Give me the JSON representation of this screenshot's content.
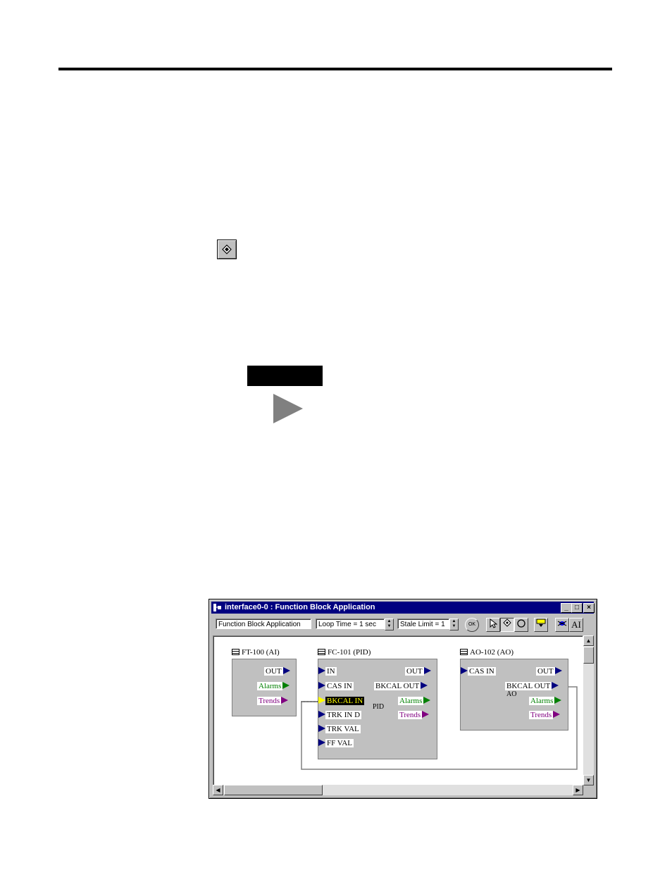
{
  "window": {
    "title": "interface0-0 : Function Block Application",
    "controls": {
      "minimize": "_",
      "maximize": "□",
      "close": "×"
    }
  },
  "toolbar": {
    "app_name": "Function Block Application",
    "loop_time": "Loop Time = 1 sec",
    "stale_limit": "Stale Limit = 1",
    "ok_label": "OK",
    "text_tool_label": "AI"
  },
  "blocks": {
    "ft100": {
      "title": "FT-100 (AI)",
      "outputs": [
        "OUT",
        "Alarms",
        "Trends"
      ]
    },
    "fc101": {
      "title": "FC-101 (PID)",
      "inputs": [
        "IN",
        "CAS IN",
        "BKCAL IN",
        "TRK IN D",
        "TRK VAL",
        "FF VAL"
      ],
      "outputs": [
        "OUT",
        "BKCAL OUT",
        "Alarms",
        "Trends"
      ],
      "tag": "PID"
    },
    "ao102": {
      "title": "AO-102 (AO)",
      "inputs": [
        "CAS IN"
      ],
      "outputs": [
        "OUT",
        "BKCAL OUT",
        "Alarms",
        "Trends"
      ],
      "tag": "AO"
    }
  },
  "colors": {
    "titlebar": "#000080",
    "port_input": "#000080",
    "port_alarm": "#008000",
    "port_trend": "#800080",
    "selected_port": "#ffff00"
  }
}
